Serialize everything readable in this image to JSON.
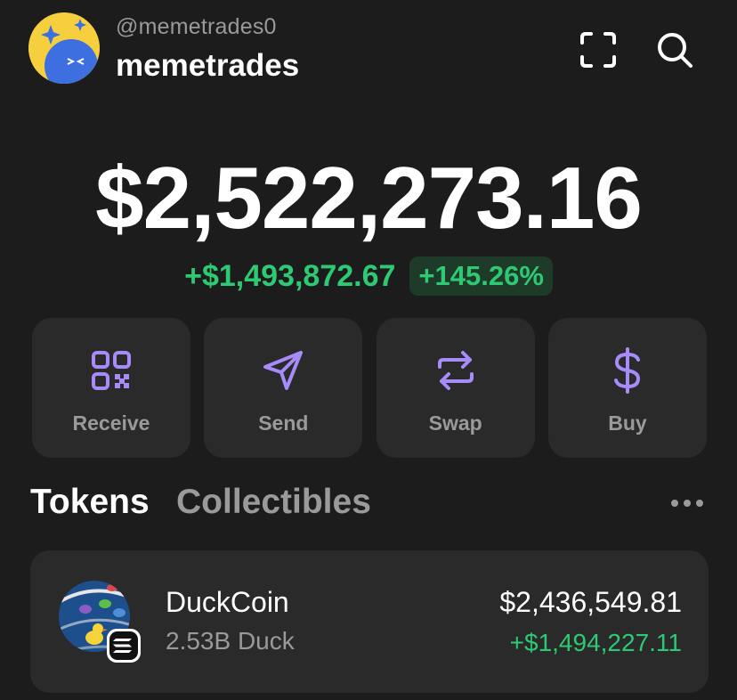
{
  "profile": {
    "handle": "@memetrades0",
    "name": "memetrades"
  },
  "header_icons": [
    "scan-icon",
    "search-icon"
  ],
  "balance": {
    "total": "$2,522,273.16",
    "change_amount": "+$1,493,872.67",
    "change_percent": "+145.26%"
  },
  "actions": [
    {
      "label": "Receive",
      "icon": "qr-code-icon"
    },
    {
      "label": "Send",
      "icon": "send-icon"
    },
    {
      "label": "Swap",
      "icon": "swap-icon"
    },
    {
      "label": "Buy",
      "icon": "dollar-icon"
    }
  ],
  "tabs": [
    {
      "label": "Tokens",
      "active": true
    },
    {
      "label": "Collectibles",
      "active": false
    }
  ],
  "tokens": [
    {
      "name": "DuckCoin",
      "amount": "2.53B Duck",
      "value": "$2,436,549.81",
      "change": "+$1,494,227.11",
      "chain_badge": "solana-icon"
    }
  ],
  "colors": {
    "background": "#1c1c1c",
    "card": "#2a2a2a",
    "accent": "#a78bfa",
    "positive": "#2ec973",
    "positive_bg": "#1d3b28",
    "muted_text": "#9a9a9a"
  }
}
